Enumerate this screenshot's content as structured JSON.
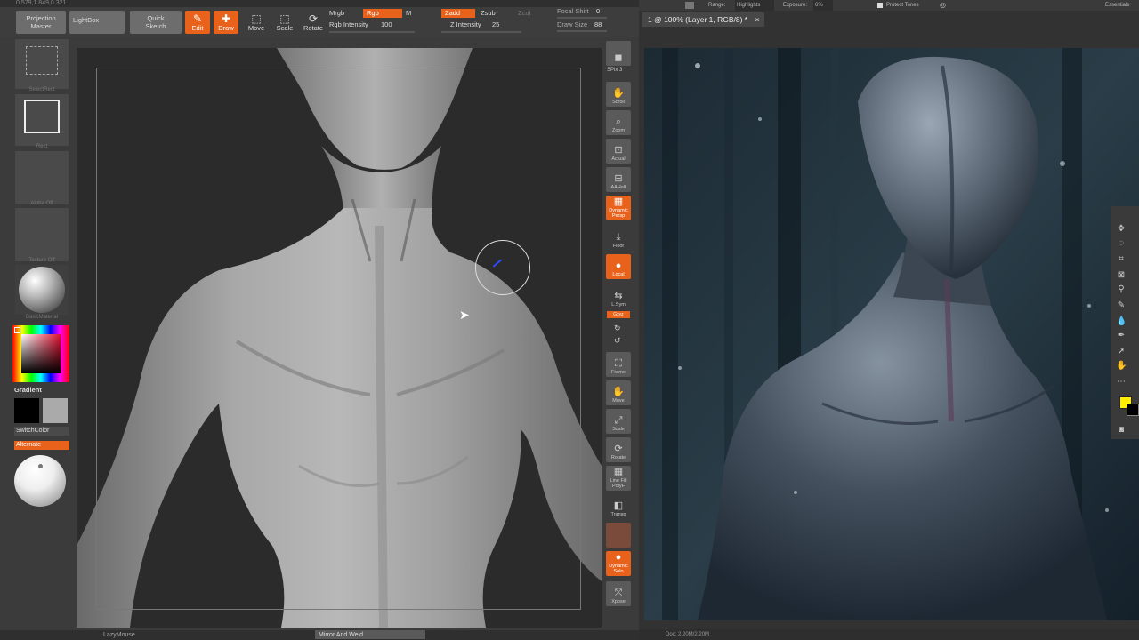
{
  "zbrush": {
    "top_strip_text": "0.579,1.849,0.321",
    "toolbar": {
      "projection_master": "Projection\nMaster",
      "lightbox": "LightBox",
      "quick_sketch": "Quick\nSketch",
      "edit": "Edit",
      "draw": "Draw",
      "move": "Move",
      "scale": "Scale",
      "rotate": "Rotate",
      "mrgb": "Mrgb",
      "rgb": "Rgb",
      "m": "M",
      "zadd": "Zadd",
      "zsub": "Zsub",
      "zcut": "Zcut",
      "rgb_intensity_label": "Rgb Intensity",
      "rgb_intensity_value": "100",
      "z_intensity_label": "Z Intensity",
      "z_intensity_value": "25",
      "focal_shift_label": "Focal Shift",
      "focal_shift_value": "0",
      "draw_size_label": "Draw Size",
      "draw_size_value": "88"
    },
    "left_shelf": {
      "select_rect": "SelectRect",
      "rect": "Rect",
      "alpha_off": "Alpha Off",
      "texture_off": "Texture Off",
      "basic_material": "BasicMaterial",
      "gradient": "Gradient",
      "switch_color": "SwitchColor",
      "alternate": "Alternate"
    },
    "right_shelf": {
      "spix_label": "SPix",
      "spix_value": "3",
      "scroll": "Scroll",
      "zoom": "Zoom",
      "actual": "Actual",
      "aahalf": "AAHalf",
      "dynamic_persp": "Dynamic\nPersp",
      "floor": "Floor",
      "local": "Local",
      "lsym": "L.Sym",
      "xyz": "Gxyz",
      "frame": "Frame",
      "move": "Move",
      "scale": "Scale",
      "rotate": "Rotate",
      "line_fill": "Line Fill\nPolyF",
      "transp": "Transp",
      "dynamic_solo": "Dynamic\nSolo",
      "xpose": "Xpose"
    },
    "status": {
      "lazymouse": "LazyMouse",
      "mirror_weld": "Mirror And Weld"
    }
  },
  "photoshop": {
    "options_bar": {
      "range": "Range:",
      "range_value": "Highlights",
      "exposure": "Exposure:",
      "exposure_value": "6%",
      "protect_tones": "Protect Tones",
      "workspace": "Essentials"
    },
    "doc_tab": "1 @ 100% (Layer 1, RGB/8) *",
    "status": "Doc: 2.20M/2.20M"
  },
  "colors": {
    "accent": "#e8621c",
    "zbrush_bg": "#3b3b3b",
    "canvas_bg": "#2b2b2b",
    "ps_bg": "#323232"
  }
}
